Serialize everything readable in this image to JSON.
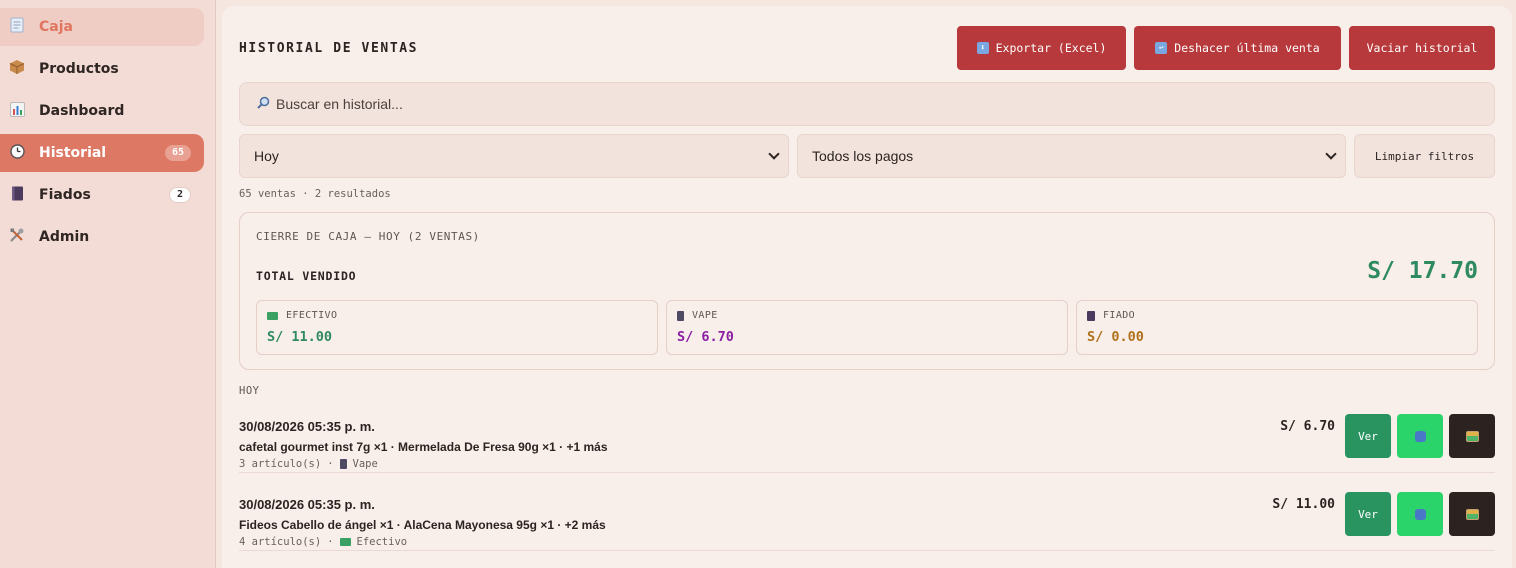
{
  "sidebar": {
    "items": [
      {
        "label": "Caja",
        "icon": "receipt-icon"
      },
      {
        "label": "Productos",
        "icon": "package-icon"
      },
      {
        "label": "Dashboard",
        "icon": "bar-chart-icon"
      },
      {
        "label": "Historial",
        "icon": "clock-icon",
        "badge": "65"
      },
      {
        "label": "Fiados",
        "icon": "notebook-icon",
        "badge": "2"
      },
      {
        "label": "Admin",
        "icon": "tools-icon"
      }
    ]
  },
  "header": {
    "title": "HISTORIAL DE VENTAS",
    "export_label": "Exportar (Excel)",
    "undo_label": "Deshacer última venta",
    "clear_history_label": "Vaciar historial"
  },
  "search": {
    "placeholder": "Buscar en historial...",
    "icon": "magnifier-icon"
  },
  "filters": {
    "period_selected": "Hoy",
    "payment_selected": "Todos los pagos",
    "clear_label": "Limpiar filtros"
  },
  "summary_text": "65 ventas · 2 resultados",
  "cierre": {
    "heading": "CIERRE DE CAJA — HOY (2 VENTAS)",
    "total_label": "TOTAL VENDIDO",
    "total_value": "S/ 17.70",
    "methods": [
      {
        "label": "EFECTIVO",
        "value": "S/ 11.00",
        "color": "#2e8a5f",
        "icon": "cash-icon"
      },
      {
        "label": "VAPE",
        "value": "S/ 6.70",
        "color": "#8a1fa3",
        "icon": "phone-icon"
      },
      {
        "label": "FIADO",
        "value": "S/ 0.00",
        "color": "#b0701a",
        "icon": "notebook-icon"
      }
    ]
  },
  "group_label": "HOY",
  "sales": [
    {
      "datetime": "30/08/2026 05:35 p. m.",
      "items": "cafetal gourmet inst 7g ×1 · Mermelada De Fresa 90g ×1 · +1 más",
      "count": "3 artículo(s)",
      "method": "Vape",
      "method_icon": "phone-icon",
      "amount": "S/ 6.70",
      "ver_label": "Ver"
    },
    {
      "datetime": "30/08/2026 05:35 p. m.",
      "items": "Fideos Cabello de ángel ×1 · AlaCena Mayonesa 95g ×1 · +2 más",
      "count": "4 artículo(s)",
      "method": "Efectivo",
      "method_icon": "cash-icon",
      "amount": "S/ 11.00",
      "ver_label": "Ver"
    }
  ],
  "colors": {
    "accent": "#dd7865",
    "danger": "#b8393b",
    "success": "#2a9461",
    "whatsapp": "#2bd46b"
  }
}
